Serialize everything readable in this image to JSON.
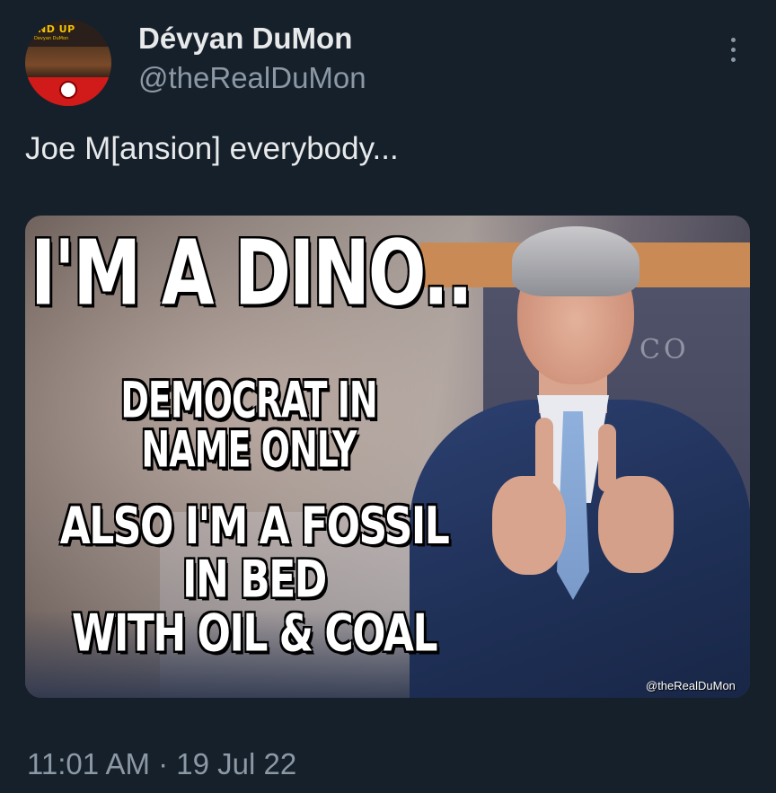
{
  "tweet": {
    "author": {
      "display_name": "Dévyan DuMon",
      "handle": "@theRealDuMon",
      "avatar_text": "ND UP",
      "avatar_subtext": "Devyan DuMon"
    },
    "text": "Joe M[ansion] everybody...",
    "media": {
      "meme_title": "I'M A DINO..",
      "meme_line1": "DEMOCRAT IN",
      "meme_line2": "NAME ONLY",
      "meme_line3": "ALSO I'M A FOSSIL",
      "meme_line4": "IN BED",
      "meme_line5": "WITH OIL & COAL",
      "backdrop_text": "CO",
      "watermark": "@theRealDuMon"
    },
    "timestamp": "11:01 AM · 19 Jul 22"
  },
  "more_menu_icon": "more-vertical-icon",
  "colors": {
    "background": "#16202a",
    "primary_text": "#e7e9ea",
    "secondary_text": "#8b98a5"
  }
}
